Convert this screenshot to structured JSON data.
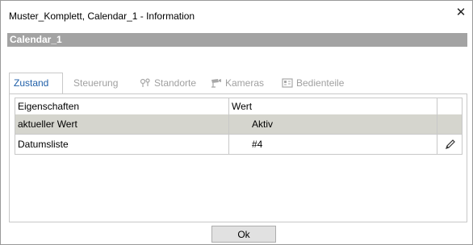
{
  "window": {
    "title": "Muster_Komplett, Calendar_1 - Information",
    "close_label": "✕"
  },
  "object_name": "Calendar_1",
  "tabs": [
    {
      "label": "Zustand",
      "active": true
    },
    {
      "label": "Steuerung",
      "active": false
    },
    {
      "label": "Standorte",
      "active": false
    },
    {
      "label": "Kameras",
      "active": false
    },
    {
      "label": "Bedienteile",
      "active": false
    }
  ],
  "table": {
    "headers": [
      "Eigenschaften",
      "Wert",
      ""
    ],
    "rows": [
      {
        "property": "aktueller Wert",
        "value": "Aktiv",
        "selected": true
      },
      {
        "property": "Datumsliste",
        "value": "#4",
        "selected": false
      }
    ]
  },
  "footer": {
    "ok_label": "Ok"
  },
  "colors": {
    "accent": "#1f5fa8",
    "namebar": "#a3a3a3",
    "selected_row": "#d5d5ce"
  }
}
